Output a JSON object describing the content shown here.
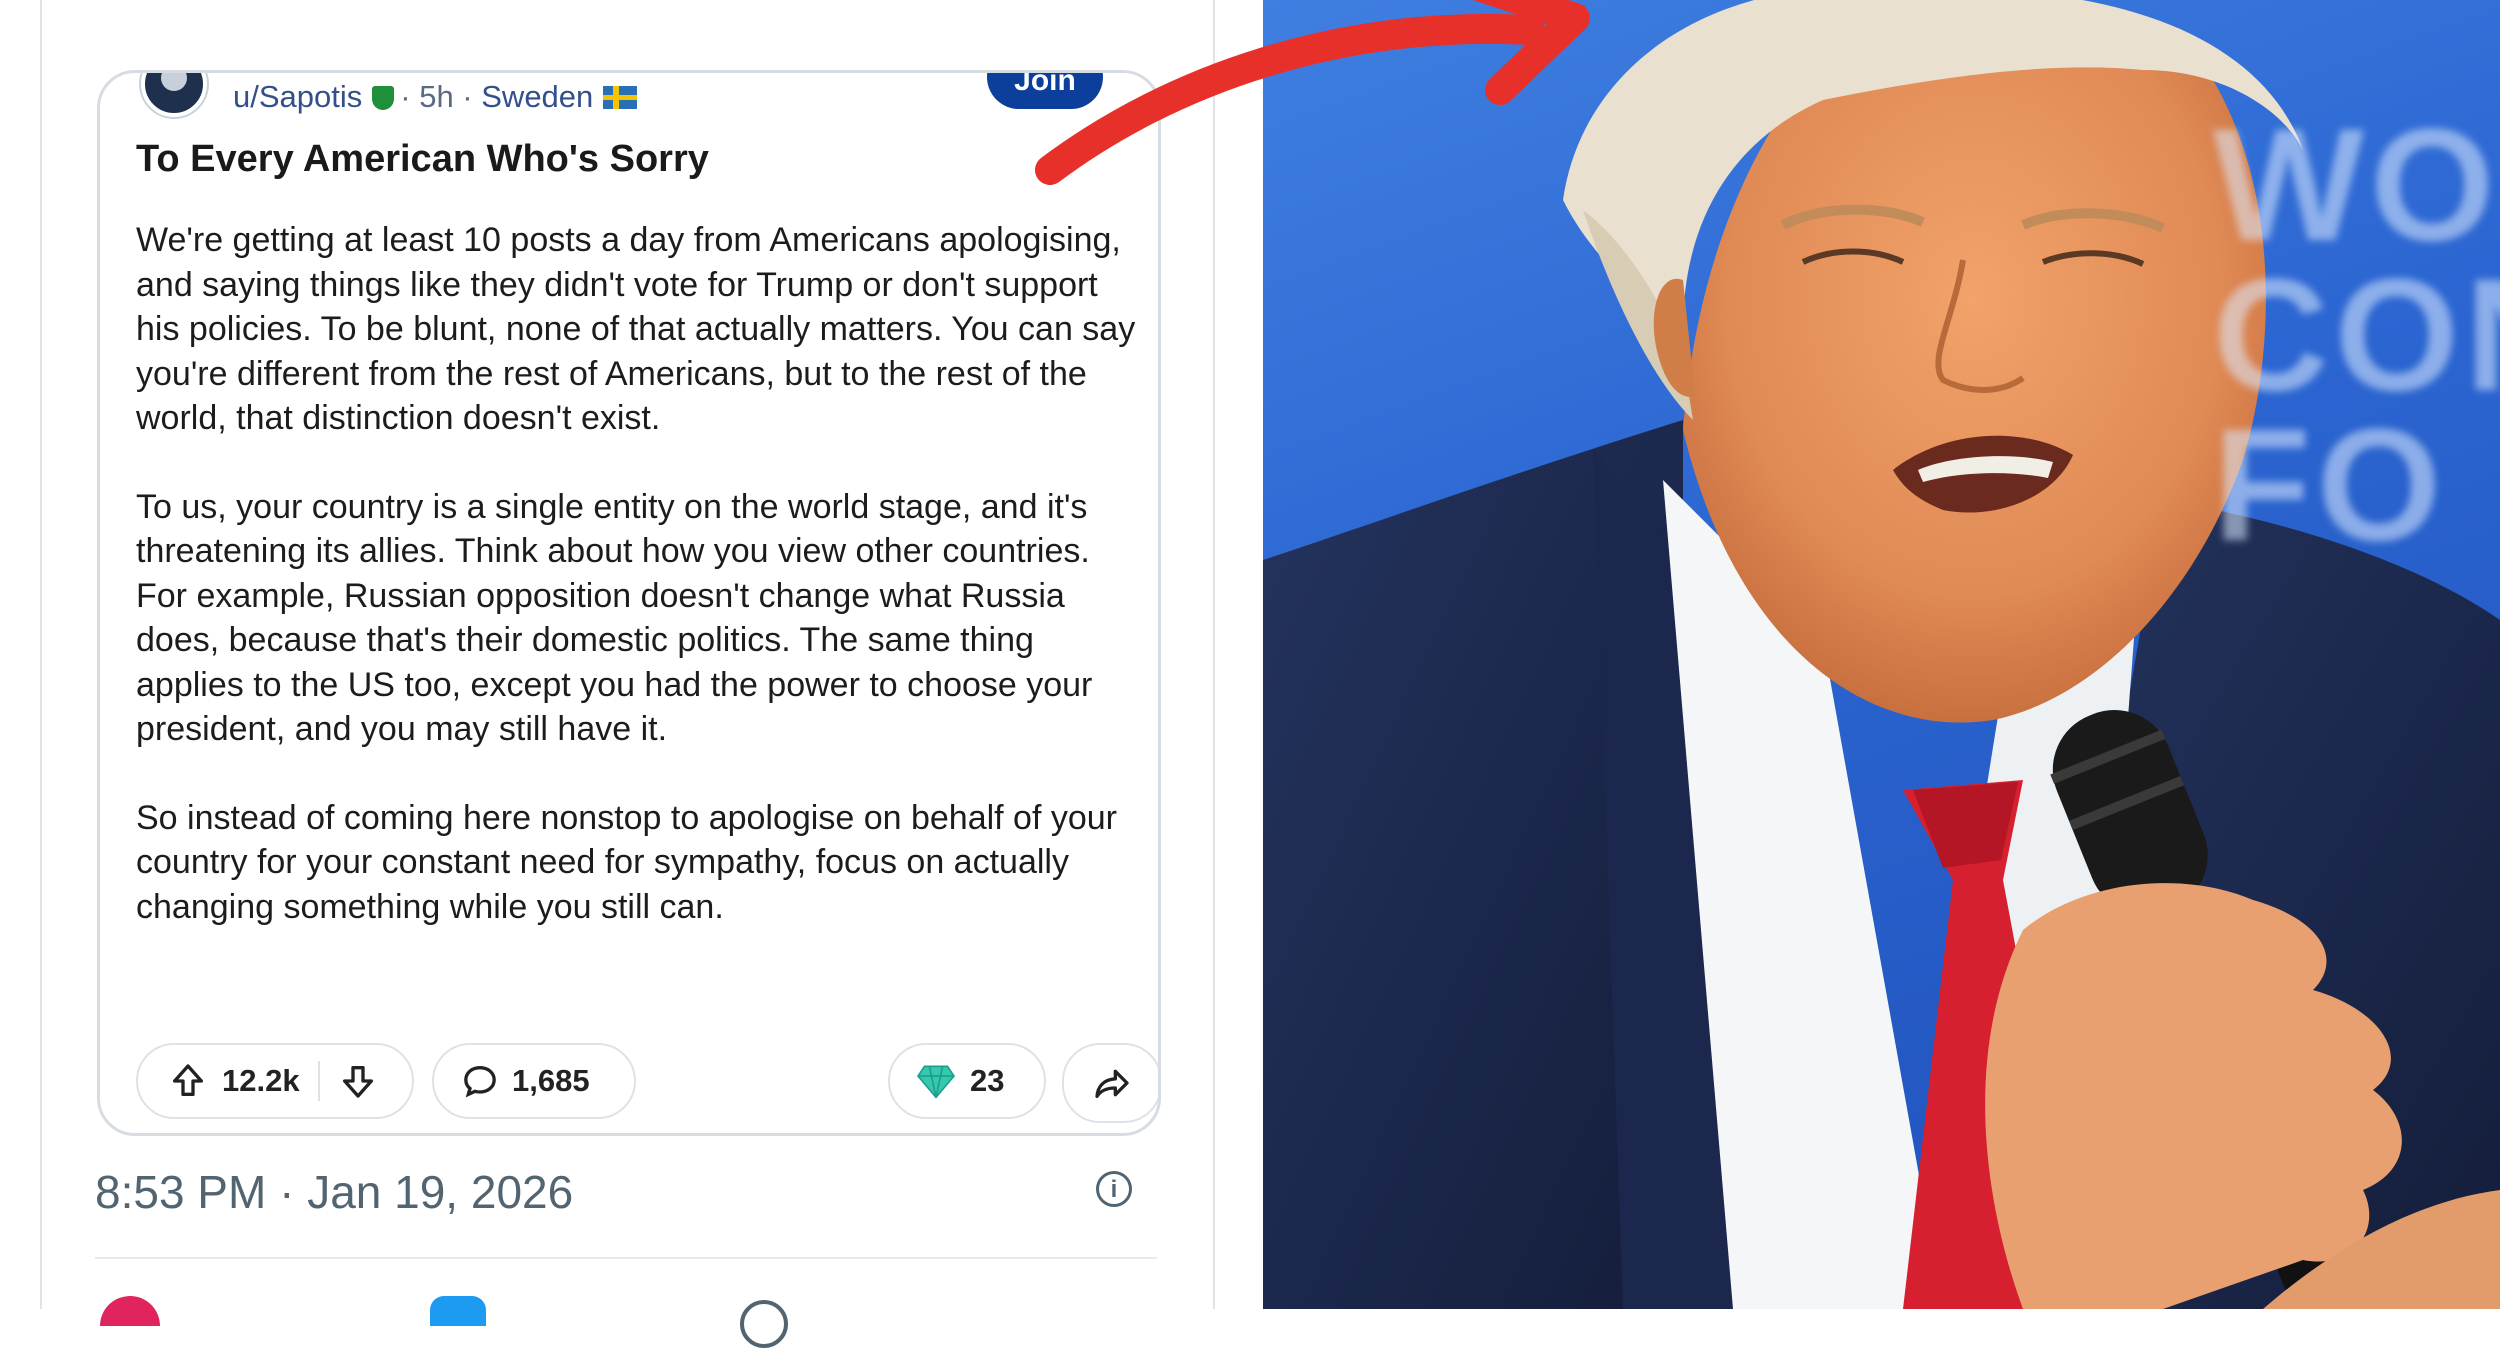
{
  "post": {
    "username": "u/Sapotis",
    "time_ago": "5h",
    "location": "Sweden",
    "join_label": "Join",
    "title": "To Every American Who's Sorry",
    "paragraphs": [
      "We're getting at least 10 posts a day from Americans apologising, and saying things like they didn't vote for Trump or don't support his policies. To be blunt, none of that actually matters. You can say you're different from the rest of Americans, but to the rest of the world, that distinction doesn't exist.",
      "To us, your country is a single entity on the world stage, and it's threatening its allies. Think about how you view other countries. For example, Russian opposition doesn't change what Russia does, because that's their domestic politics. The same thing applies to the US too, except you had the power to choose your president, and you may still have it.",
      "So instead of coming here nonstop to apologise on behalf of your country for your constant need for sympathy, focus on actually changing something while you still can."
    ],
    "upvotes": "12.2k",
    "comments": "1,685",
    "awards": "23"
  },
  "tweet": {
    "timestamp": "8:53 PM · Jan 19, 2026"
  },
  "background_text": "WO\nCON\nFO",
  "colors": {
    "accent_red_arrow": "#e8302a",
    "join_button": "#0c3f9b",
    "tie": "#d6202f",
    "suit": "#1c2a52"
  },
  "icons": [
    "upvote-icon",
    "downvote-icon",
    "comment-icon",
    "award-icon",
    "share-icon",
    "info-icon",
    "heart-icon",
    "reply-icon"
  ]
}
